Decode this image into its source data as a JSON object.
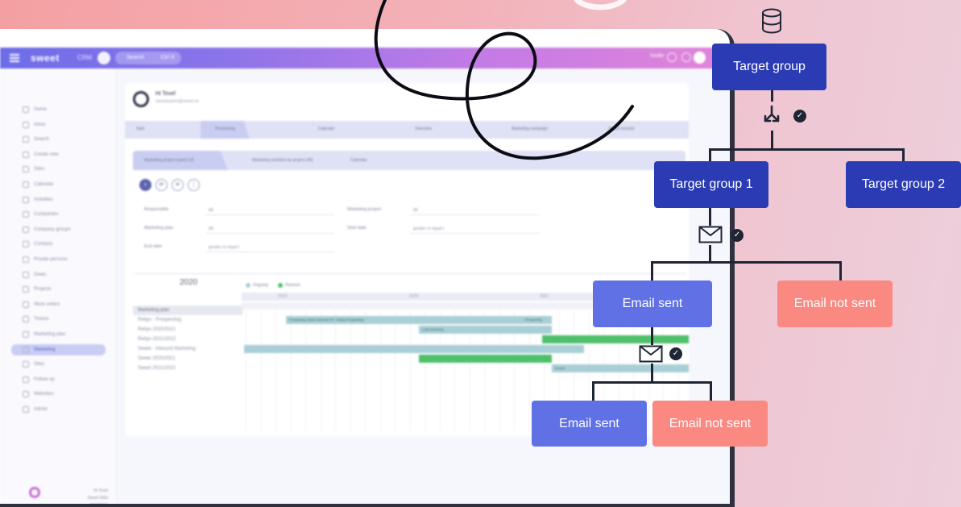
{
  "app": {
    "brand": "sweet",
    "brand_sub": "CRM",
    "search_placeholder": "Search",
    "search_shortcut": "Ctrl K",
    "topbar_right": "Invite",
    "sidebar": {
      "items": [
        {
          "label": "Home"
        },
        {
          "label": "Inbox"
        },
        {
          "label": "Search"
        },
        {
          "label": "Create new"
        },
        {
          "label": "Sites"
        },
        {
          "label": "Calendar"
        },
        {
          "label": "Activities"
        },
        {
          "label": "Companies"
        },
        {
          "label": "Company groups"
        },
        {
          "label": "Contacts"
        },
        {
          "label": "Private persons"
        },
        {
          "label": "Deals"
        },
        {
          "label": "Projects"
        },
        {
          "label": "Work orders"
        },
        {
          "label": "Tickets"
        },
        {
          "label": "Marketing plan"
        },
        {
          "label": "Marketing"
        },
        {
          "label": "Sites"
        },
        {
          "label": "Follow up"
        },
        {
          "label": "Websites"
        },
        {
          "label": "Admin"
        }
      ],
      "active_index": 16,
      "footer_name": "Hi Tovel",
      "footer_sub": "Sweet Web @SWEET"
    },
    "person": {
      "name": "Hi Tovel",
      "sub": "sweetsystem@sweet.se"
    },
    "tabs": [
      "Start",
      "Processing",
      "Calendar",
      "Overview",
      "Marketing campaign",
      "Import records"
    ],
    "active_tab": 1,
    "subtabs": [
      "Marketing project (open) (3)",
      "Marketing activities by project (45)",
      "Calendar"
    ],
    "active_subtab": 0,
    "tools": [
      "+",
      "⟳",
      "✕",
      "⋮"
    ],
    "filters": {
      "responsible_label": "Responsible",
      "responsible_value": "All",
      "marketing_project_label": "Marketing project",
      "marketing_project_value": "All",
      "marketing_plan_label": "Marketing plan",
      "marketing_plan_value": "All",
      "start_date_label": "Start date",
      "start_date_value": "greater or equal t",
      "end_date_label": "End date",
      "end_date_value": "greater or equal t"
    },
    "gantt": {
      "year": "2020",
      "legend_ongoing": "Ongoing",
      "legend_planned": "Planned",
      "periods": [
        "2019",
        "2020",
        "2021"
      ],
      "rows": [
        {
          "label": "Marketing plan",
          "head": true
        },
        {
          "label": "Retiyo - Prospecting"
        },
        {
          "label": "Retiyo 2020/2021"
        },
        {
          "label": "Retiyo 2021/2022"
        },
        {
          "label": "Sweet - Inbound Marketing"
        },
        {
          "label": "Sweet 2020/2021"
        },
        {
          "label": "Sweet 2021/2022"
        }
      ],
      "bar_labels": {
        "prospecting": "Prospecting Sweet Inbound TR - Retiyo Prospecting",
        "prospecting_end": "Prospecting",
        "retiyo_2020": "Lead Nurturing",
        "sweet_2022": "Events"
      },
      "colors": {
        "ongoing": "#a9cfd6",
        "planned": "#4ec06b"
      }
    }
  },
  "flow": {
    "root": "Target group",
    "group1": "Target group 1",
    "group2": "Target group 2",
    "sent_1": "Email sent",
    "not_sent_1": "Email not sent",
    "sent_2": "Email sent",
    "not_sent_2": "Email not sent",
    "icons": [
      "database-icon",
      "split-icon",
      "envelope-icon",
      "check-icon"
    ],
    "colors": {
      "navy": "#2b3bb3",
      "blue": "#6071e6",
      "salmon": "#fa8982",
      "line": "#1f2535"
    }
  }
}
